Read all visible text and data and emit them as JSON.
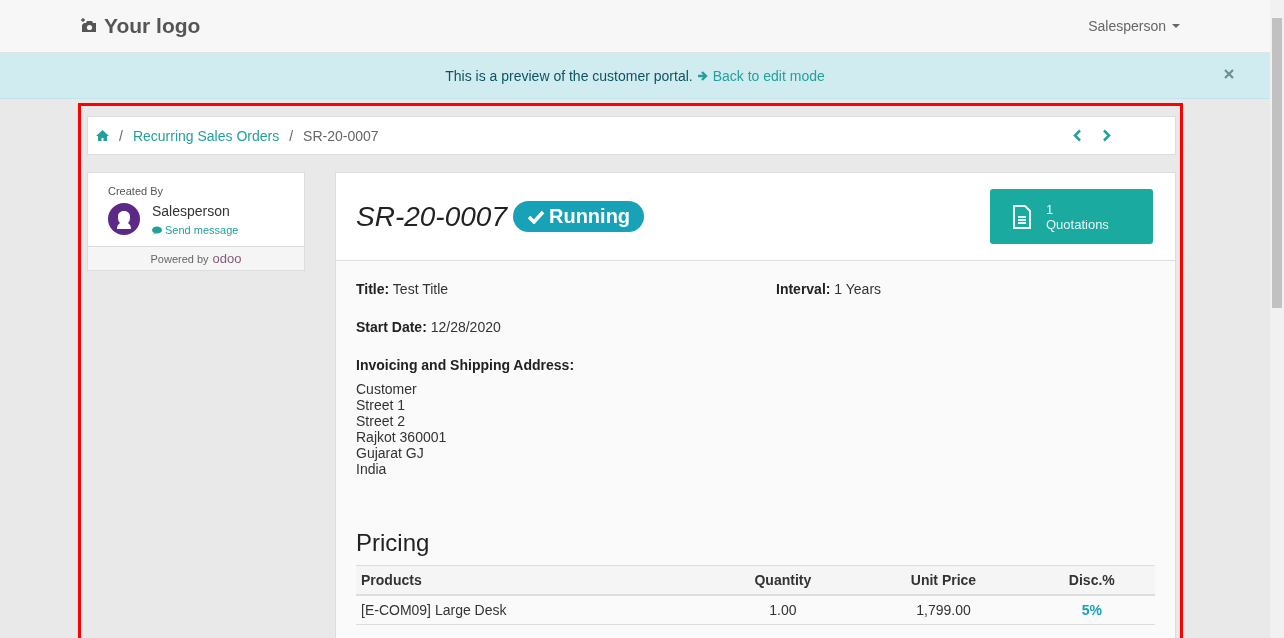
{
  "navbar": {
    "logo": "Your logo",
    "user_menu": "Salesperson"
  },
  "preview_alert": {
    "message": "This is a preview of the customer portal.",
    "link": "Back to edit mode"
  },
  "breadcrumb": {
    "separator": "/",
    "items": [
      "Recurring Sales Orders",
      "SR-20-0007"
    ]
  },
  "sidebar": {
    "created_by_label": "Created By",
    "person": "Salesperson",
    "send_message": "Send message",
    "powered_by": "Powered by",
    "brand": "odoo"
  },
  "order": {
    "number": "SR-20-0007",
    "status": "Running",
    "quotations_count": "1",
    "quotations_label": "Quotations",
    "fields": [
      {
        "label": "Title:",
        "value": "Test Title"
      },
      {
        "label": "Interval:",
        "value": "1 Years"
      },
      {
        "label": "Start Date:",
        "value": "12/28/2020"
      }
    ],
    "address_label": "Invoicing and Shipping Address:",
    "address_lines": [
      "Customer",
      "Street 1",
      "Street 2",
      "Rajkot 360001",
      "Gujarat GJ",
      "India"
    ]
  },
  "pricing": {
    "title": "Pricing",
    "columns": [
      "Products",
      "Quantity",
      "Unit Price",
      "Disc.%"
    ],
    "rows": [
      [
        "[E-COM09] Large Desk",
        "1.00",
        "1,799.00",
        "5%"
      ]
    ]
  }
}
